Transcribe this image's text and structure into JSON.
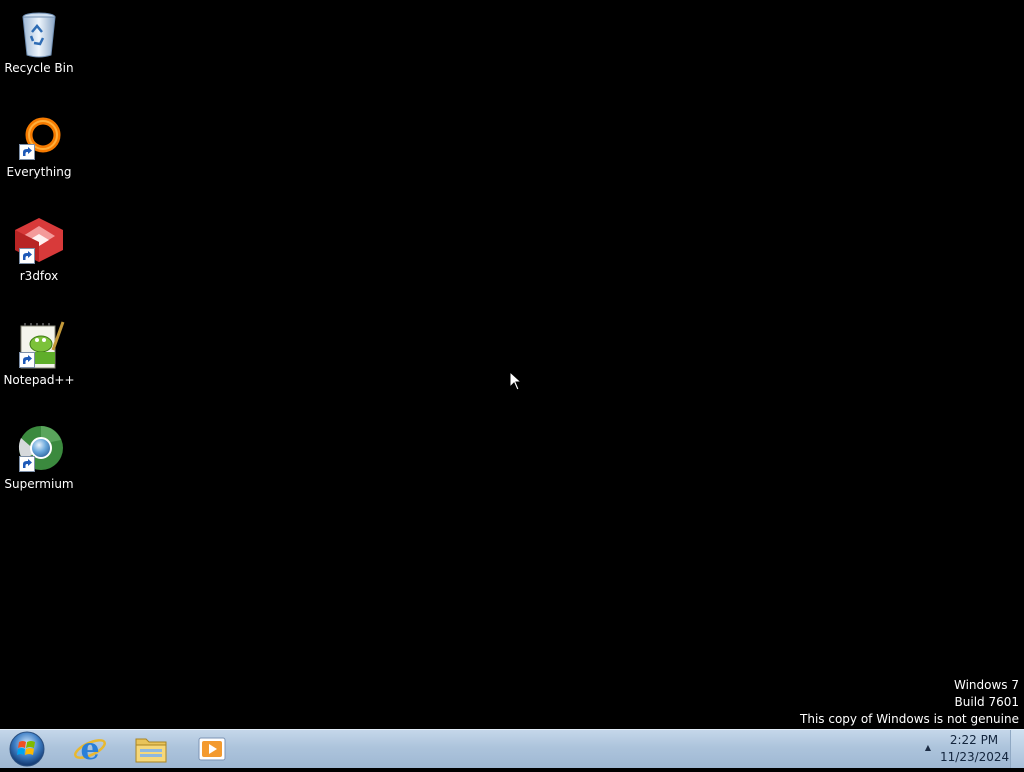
{
  "desktop": {
    "icons": [
      {
        "label": "Recycle Bin",
        "icon": "recycle-bin-icon",
        "shortcut": false
      },
      {
        "label": "Everything",
        "icon": "everything-icon",
        "shortcut": true
      },
      {
        "label": "r3dfox",
        "icon": "r3dfox-icon",
        "shortcut": true
      },
      {
        "label": "Notepad++",
        "icon": "notepad-plus-plus-icon",
        "shortcut": true
      },
      {
        "label": "Supermium",
        "icon": "supermium-icon",
        "shortcut": true
      }
    ],
    "background_color": "#000000"
  },
  "watermark": {
    "line1": "Windows 7",
    "line2": "Build 7601",
    "line3": "This copy of Windows is not genuine"
  },
  "taskbar": {
    "start_icon": "windows-start-icon",
    "pinned": [
      {
        "icon": "internet-explorer-icon"
      },
      {
        "icon": "file-explorer-icon"
      },
      {
        "icon": "media-player-icon"
      }
    ],
    "tray_arrow": "▲",
    "clock": {
      "time": "2:22 PM",
      "date": "11/23/2024"
    }
  }
}
